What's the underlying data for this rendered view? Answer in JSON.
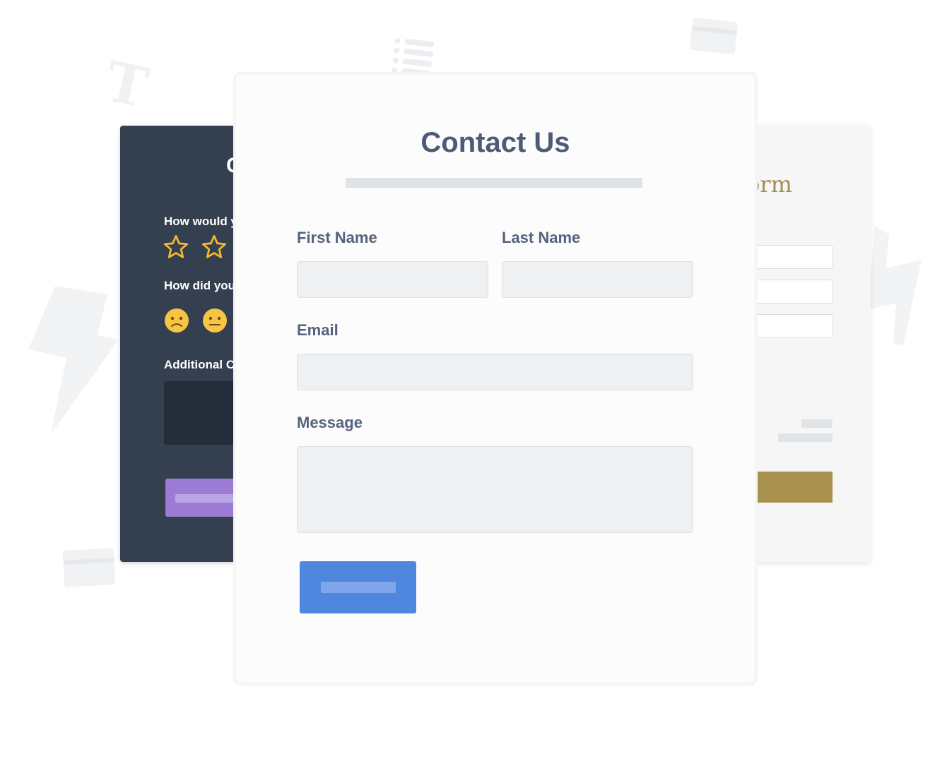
{
  "background": {
    "t_letter": "T"
  },
  "left_form": {
    "title_fragment": "C",
    "question_1": "How would y",
    "question_2": "How did you f",
    "question_3": "Additional Co",
    "star_color": "#f5b82e",
    "face_color": "#f7c544",
    "button_color": "#9b7bd3"
  },
  "right_form": {
    "title_fragment": "orm",
    "button_color": "#a8914e"
  },
  "contact_form": {
    "title": "Contact Us",
    "first_name_label": "First Name",
    "last_name_label": "Last Name",
    "email_label": "Email",
    "message_label": "Message",
    "submit_color": "#4f87df",
    "title_color": "#4e5b76"
  }
}
